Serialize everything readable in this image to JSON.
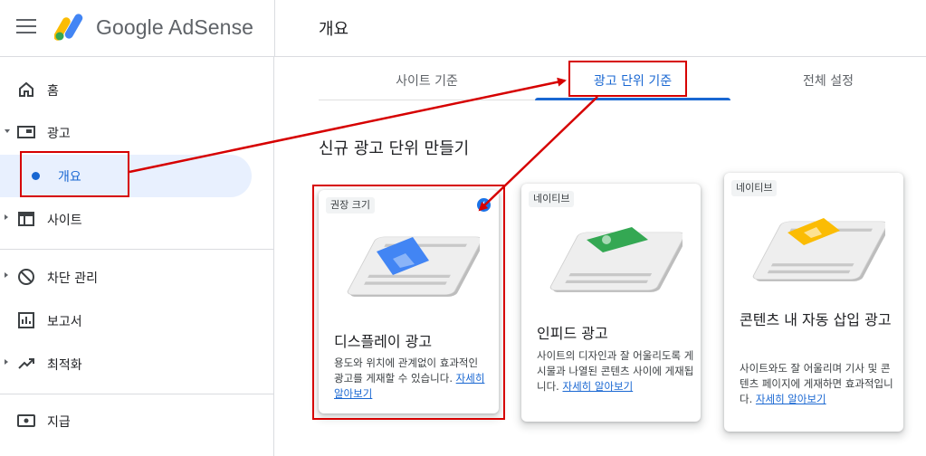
{
  "header": {
    "brand_google": "Google",
    "brand_product": "AdSense",
    "page_title": "개요"
  },
  "sidebar": {
    "items": [
      {
        "label": "홈",
        "icon": "home-icon"
      },
      {
        "label": "광고",
        "icon": "ads-icon"
      },
      {
        "label": "개요",
        "icon": "dot-icon"
      },
      {
        "label": "사이트",
        "icon": "sites-icon"
      },
      {
        "label": "차단 관리",
        "icon": "block-icon"
      },
      {
        "label": "보고서",
        "icon": "reports-icon"
      },
      {
        "label": "최적화",
        "icon": "optimize-icon"
      },
      {
        "label": "지급",
        "icon": "payments-icon"
      }
    ]
  },
  "tabs": [
    {
      "label": "사이트 기준"
    },
    {
      "label": "광고 단위 기준"
    },
    {
      "label": "전체 설정"
    }
  ],
  "section_title": "신규 광고 단위 만들기",
  "cards": [
    {
      "chip": "권장 크기",
      "title": "디스플레이 광고",
      "desc": "용도와 위치에 관계없이 효과적인 광고를 게재할 수 있습니다.",
      "link": "자세히 알아보기",
      "accent": "#4285f4"
    },
    {
      "chip": "네이티브",
      "title": "인피드 광고",
      "desc": "사이트의 디자인과 잘 어울리도록 게시물과 나열된 콘텐츠 사이에 게재됩니다.",
      "link": "자세히 알아보기",
      "accent": "#34a853"
    },
    {
      "chip": "네이티브",
      "title": "콘텐츠 내 자동 삽입 광고",
      "desc": "사이트와도 잘 어울리며 기사 및 콘텐츠 페이지에 게재하면 효과적입니다.",
      "link": "자세히 알아보기",
      "accent": "#fbbc04"
    }
  ],
  "colors": {
    "accent_blue": "#1967d2",
    "annotation_red": "#d60000"
  }
}
